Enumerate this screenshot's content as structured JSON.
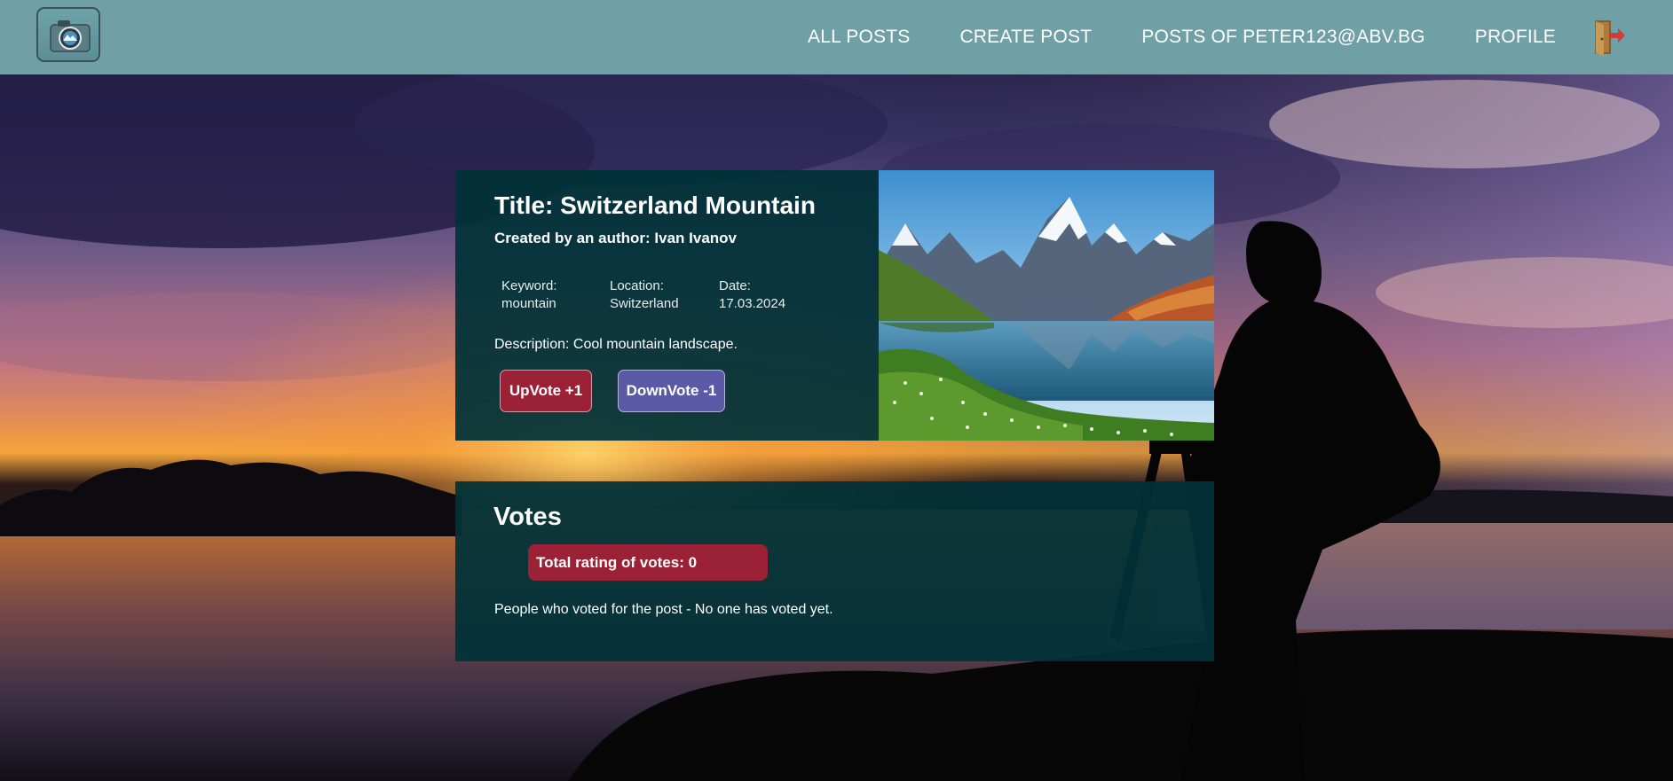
{
  "header": {
    "nav": [
      {
        "label": "ALL POSTS"
      },
      {
        "label": "CREATE POST"
      },
      {
        "label": "POSTS OF PETER123@ABV.BG"
      },
      {
        "label": "PROFILE"
      }
    ],
    "logo_icon": "camera-icon",
    "logout_icon": "logout-door-icon",
    "bar_color": "#6fa0a6"
  },
  "post": {
    "title": "Title: Switzerland Mountain",
    "author": "Created by an author: Ivan Ivanov",
    "keyword_label": "Keyword:",
    "keyword_value": "mountain",
    "location_label": "Location:",
    "location_value": "Switzerland",
    "date_label": "Date:",
    "date_value": "17.03.2024",
    "description": "Description: Cool mountain landscape.",
    "upvote_label": "UpVote +1",
    "downvote_label": "DownVote -1"
  },
  "votes": {
    "heading": "Votes",
    "total": "Total rating of votes: 0",
    "voters": "People who voted for the post - No one has voted yet."
  },
  "colors": {
    "card": "#003238",
    "upvote": "#9b2236",
    "downvote": "#5c5aa6"
  }
}
